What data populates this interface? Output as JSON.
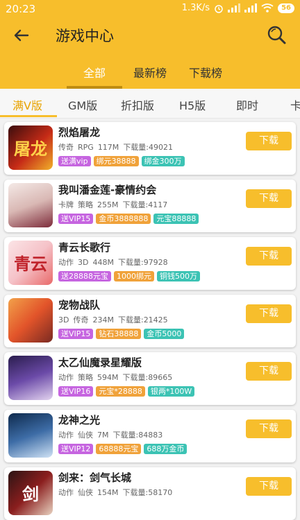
{
  "status_bar": {
    "time": "20:23",
    "speed": "1.3K/s",
    "battery": "56"
  },
  "header": {
    "title": "游戏中心"
  },
  "top_tabs": [
    {
      "label": "全部"
    },
    {
      "label": "最新榜"
    },
    {
      "label": "下载榜"
    }
  ],
  "categories": [
    "满V版",
    "GM版",
    "折扣版",
    "H5版",
    "即时",
    "卡"
  ],
  "download_label": "下载",
  "meta_prefix": "下载量:",
  "games": [
    {
      "name": "烈焰屠龙",
      "tags": [
        "传奇",
        "RPG"
      ],
      "size": "117M",
      "downloads": "49021",
      "badges": [
        {
          "text": "送满vip",
          "color": "purple"
        },
        {
          "text": "绑元38888",
          "color": "orange"
        },
        {
          "text": "绑金300万",
          "color": "teal"
        }
      ],
      "icon_text": "屠龙"
    },
    {
      "name": "我叫潘金莲-豪情约会",
      "tags": [
        "卡牌",
        "策略"
      ],
      "size": "255M",
      "downloads": "4117",
      "badges": [
        {
          "text": "送VIP15",
          "color": "purple"
        },
        {
          "text": "金币3888888",
          "color": "orange"
        },
        {
          "text": "元宝88888",
          "color": "teal"
        }
      ],
      "icon_text": ""
    },
    {
      "name": "青云长歌行",
      "tags": [
        "动作",
        "3D"
      ],
      "size": "448M",
      "downloads": "97928",
      "badges": [
        {
          "text": "送28888元宝",
          "color": "purple"
        },
        {
          "text": "1000绑元",
          "color": "orange"
        },
        {
          "text": "铜钱500万",
          "color": "teal"
        }
      ],
      "icon_text": "青云"
    },
    {
      "name": "宠物战队",
      "tags": [
        "3D",
        "传奇"
      ],
      "size": "234M",
      "downloads": "21425",
      "badges": [
        {
          "text": "送VIP15",
          "color": "purple"
        },
        {
          "text": "钻石38888",
          "color": "orange"
        },
        {
          "text": "金币5000",
          "color": "teal"
        }
      ],
      "icon_text": ""
    },
    {
      "name": "太乙仙魔录星耀版",
      "tags": [
        "动作",
        "策略"
      ],
      "size": "594M",
      "downloads": "89665",
      "badges": [
        {
          "text": "送VIP16",
          "color": "purple"
        },
        {
          "text": "元宝*28888",
          "color": "orange"
        },
        {
          "text": "银两*100W",
          "color": "teal"
        }
      ],
      "icon_text": ""
    },
    {
      "name": "龙神之光",
      "tags": [
        "动作",
        "仙侠"
      ],
      "size": "7M",
      "downloads": "84883",
      "badges": [
        {
          "text": "送VIP12",
          "color": "purple"
        },
        {
          "text": "68888元宝",
          "color": "orange"
        },
        {
          "text": "688万金币",
          "color": "teal"
        }
      ],
      "icon_text": ""
    },
    {
      "name": "剑来：剑气长城",
      "tags": [
        "动作",
        "仙侠"
      ],
      "size": "154M",
      "downloads": "58170",
      "badges": [],
      "icon_text": "剑"
    }
  ]
}
